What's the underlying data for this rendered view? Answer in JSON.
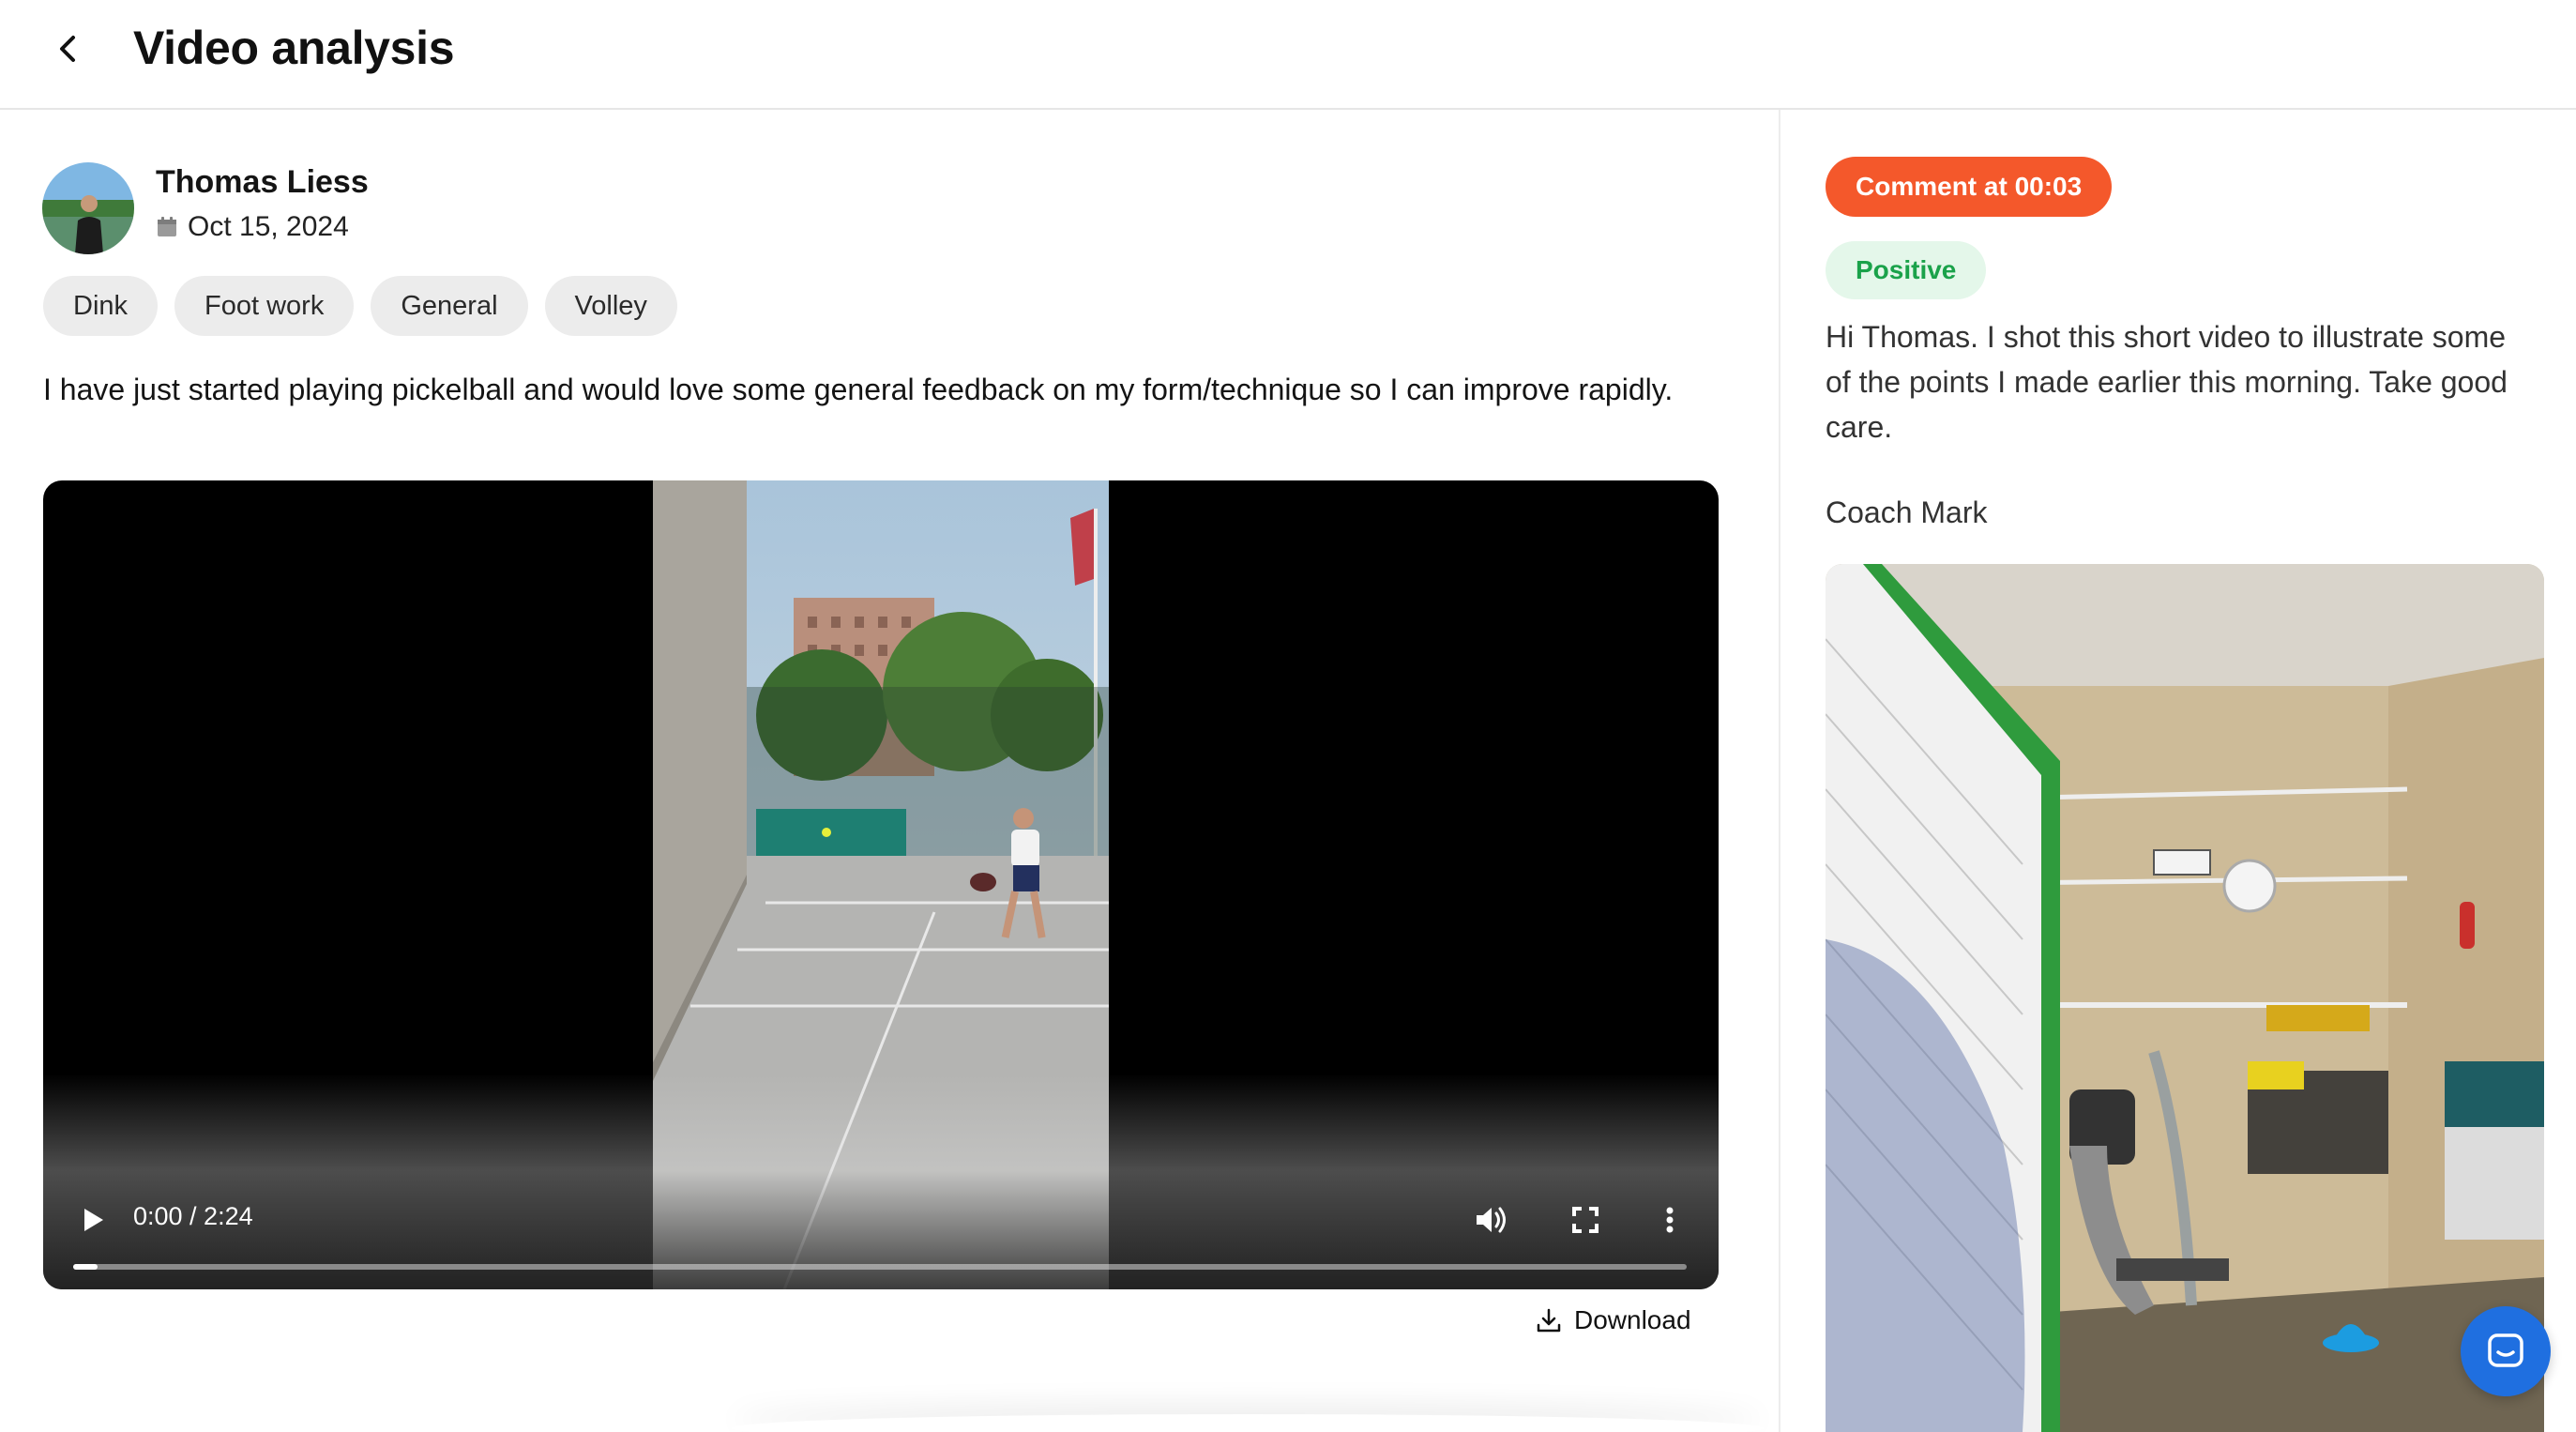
{
  "header": {
    "title": "Video analysis",
    "back_icon": "chevron-left-icon"
  },
  "post": {
    "author": "Thomas Liess",
    "date": "Oct 15, 2024",
    "date_icon": "calendar-icon",
    "tags": [
      "Dink",
      "Foot work",
      "General",
      "Volley"
    ],
    "description": "I have just started playing pickelball and would love some general feedback on my form/technique so I can improve rapidly."
  },
  "video": {
    "time": "0:00 / 2:24",
    "progress": 0.01,
    "controls": [
      "play-icon",
      "volume-icon",
      "fullscreen-icon",
      "more-vertical-icon"
    ]
  },
  "download": {
    "label": "Download",
    "icon": "download-icon"
  },
  "comment": {
    "badge": "Comment at 00:03",
    "sentiment": "Positive",
    "text": "Hi Thomas. I shot this short video to illustrate some of the points I made earlier this morning. Take good care.",
    "author": "Coach Mark"
  },
  "chat": {
    "icon": "chat-icon"
  },
  "colors": {
    "accent": "#f4582b",
    "positive_bg": "#e4f7ea",
    "positive_text": "#1aa24a",
    "chat_button": "#1f6fe0"
  }
}
